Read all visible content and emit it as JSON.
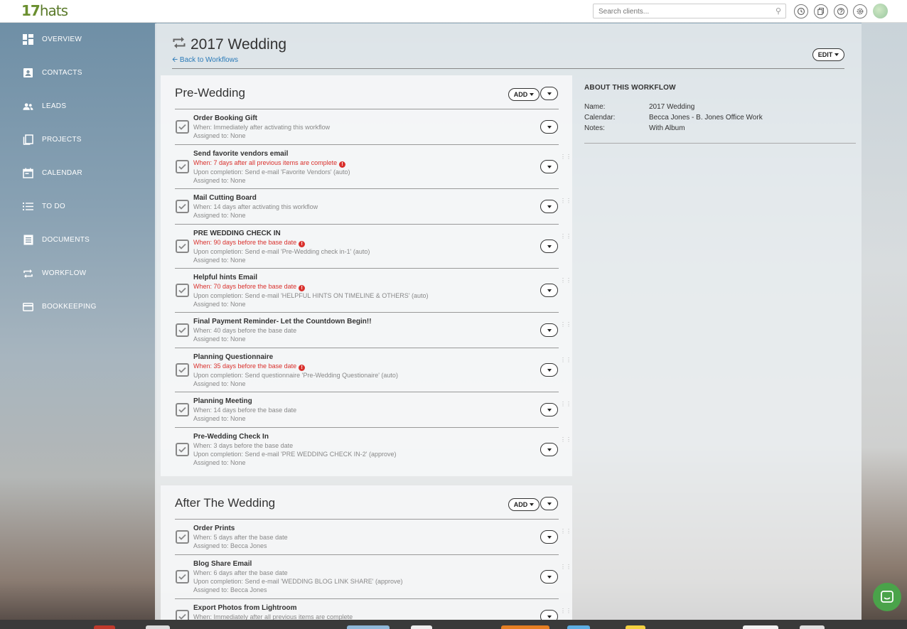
{
  "app": {
    "logo": "17",
    "logo_suffix": "hats"
  },
  "search": {
    "placeholder": "Search clients..."
  },
  "topbar_icons": [
    "clock-icon",
    "copy-icon",
    "help-icon",
    "settings-icon",
    "avatar"
  ],
  "sidebar": {
    "items": [
      {
        "label": "OVERVIEW",
        "icon": "dashboard-icon"
      },
      {
        "label": "CONTACTS",
        "icon": "contact-card-icon"
      },
      {
        "label": "LEADS",
        "icon": "people-icon"
      },
      {
        "label": "PROJECTS",
        "icon": "projects-icon"
      },
      {
        "label": "CALENDAR",
        "icon": "calendar-icon"
      },
      {
        "label": "TO DO",
        "icon": "list-icon"
      },
      {
        "label": "DOCUMENTS",
        "icon": "document-icon"
      },
      {
        "label": "WORKFLOW",
        "icon": "workflow-icon"
      },
      {
        "label": "BOOKKEEPING",
        "icon": "card-icon"
      }
    ]
  },
  "page": {
    "title": "2017 Wedding",
    "back_label": "Back to Workflows",
    "edit_label": "EDIT"
  },
  "about": {
    "heading": "ABOUT THIS WORKFLOW",
    "rows": [
      {
        "key": "Name:",
        "value": "2017 Wedding"
      },
      {
        "key": "Calendar:",
        "value": "Becca Jones - B. Jones Office Work"
      },
      {
        "key": "Notes:",
        "value": "With Album"
      }
    ]
  },
  "sections": [
    {
      "title": "Pre-Wedding",
      "add_label": "ADD",
      "items": [
        {
          "title": "Order Booking Gift",
          "when": "When: Immediately after activating this workflow",
          "when_red": false,
          "completion": "",
          "assigned": "Assigned to: None"
        },
        {
          "title": "Send favorite vendors email",
          "when": "When: 7 days after all previous items are complete",
          "when_red": true,
          "completion": "Upon completion: Send e-mail 'Favorite Vendors' (auto)",
          "assigned": "Assigned to: None"
        },
        {
          "title": "Mail Cutting Board",
          "when": "When: 14 days after activating this workflow",
          "when_red": false,
          "completion": "",
          "assigned": "Assigned to: None"
        },
        {
          "title": "PRE WEDDING CHECK IN",
          "when": "When: 90 days before the base date",
          "when_red": true,
          "completion": "Upon completion: Send e-mail 'Pre-Wedding check in-1' (auto)",
          "assigned": "Assigned to: None"
        },
        {
          "title": "Helpful hints Email",
          "when": "When: 70 days before the base date",
          "when_red": true,
          "completion": "Upon completion: Send e-mail 'HELPFUL HINTS ON TIMELINE & OTHERS' (auto)",
          "assigned": "Assigned to: None"
        },
        {
          "title": "Final Payment Reminder- Let the Countdown Begin!!",
          "when": "When: 40 days before the base date",
          "when_red": false,
          "completion": "",
          "assigned": "Assigned to: None"
        },
        {
          "title": "Planning Questionnaire",
          "when": "When: 35 days before the base date",
          "when_red": true,
          "completion": "Upon completion: Send questionnaire 'Pre-Wedding Questionaire' (auto)",
          "assigned": "Assigned to: None"
        },
        {
          "title": "Planning Meeting",
          "when": "When: 14 days before the base date",
          "when_red": false,
          "completion": "",
          "assigned": "Assigned to: None"
        },
        {
          "title": "Pre-Wedding Check In",
          "when": "When: 3 days before the base date",
          "when_red": false,
          "completion": "Upon completion: Send e-mail 'PRE WEDDING CHECK IN-2' (approve)",
          "assigned": "Assigned to: None"
        }
      ]
    },
    {
      "title": "After The Wedding",
      "add_label": "ADD",
      "items": [
        {
          "title": "Order Prints",
          "when": "When: 5 days after the base date",
          "when_red": false,
          "completion": "",
          "assigned": "Assigned to: Becca Jones"
        },
        {
          "title": "Blog Share Email",
          "when": "When: 6 days after the base date",
          "when_red": false,
          "completion": "Upon completion: Send e-mail 'WEDDING BLOG LINK SHARE' (approve)",
          "assigned": "Assigned to: Becca Jones"
        },
        {
          "title": "Export Photos from Lightroom",
          "when": "When: Immediately after all previous items are complete",
          "when_red": false,
          "completion": "",
          "assigned": ""
        }
      ]
    }
  ]
}
